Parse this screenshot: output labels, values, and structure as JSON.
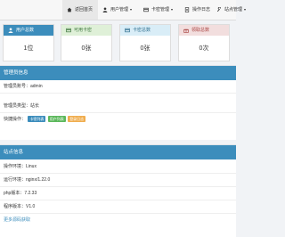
{
  "topnav": {
    "tabs": [
      {
        "label": "返回首页",
        "icon": "home-icon"
      },
      {
        "label": "用户管理",
        "icon": "user-icon",
        "caret": "▾"
      },
      {
        "label": "卡密管理",
        "icon": "card-icon",
        "caret": "▾"
      },
      {
        "label": "操作日志",
        "icon": "log-icon"
      },
      {
        "label": "站点管理",
        "icon": "wrench-icon",
        "caret": "▾"
      }
    ]
  },
  "cards": [
    {
      "label": "用户总数",
      "value": "1位",
      "color": "#3c8dbc",
      "icon": "user-icon"
    },
    {
      "label": "可用卡密",
      "value": "0张",
      "color": "#dff0d8",
      "icon": "card-icon"
    },
    {
      "label": "卡密总数",
      "value": "0张",
      "color": "#d9edf7",
      "icon": "card-icon"
    },
    {
      "label": "领取总数",
      "value": "0次",
      "color": "#f2dede",
      "icon": "gift-icon"
    }
  ],
  "admin": {
    "title": "管理员信息",
    "account": "管理员账号：admin",
    "type": "管理员类型：站长",
    "shortcut_label": "快捷操作：",
    "shortcuts": [
      {
        "label": "卡密列表",
        "color": "#3c8dbc"
      },
      {
        "label": "用户列表",
        "color": "#5cb85c"
      },
      {
        "label": "登录日志",
        "color": "#f0ad4e"
      }
    ]
  },
  "site": {
    "title": "站点信息",
    "os": "操作环境：Linux",
    "server": "运行环境：nginx/1.22.0",
    "php": "php版本：7.2.33",
    "version": "程序版本：V1.0",
    "more": "更多源码获取"
  }
}
